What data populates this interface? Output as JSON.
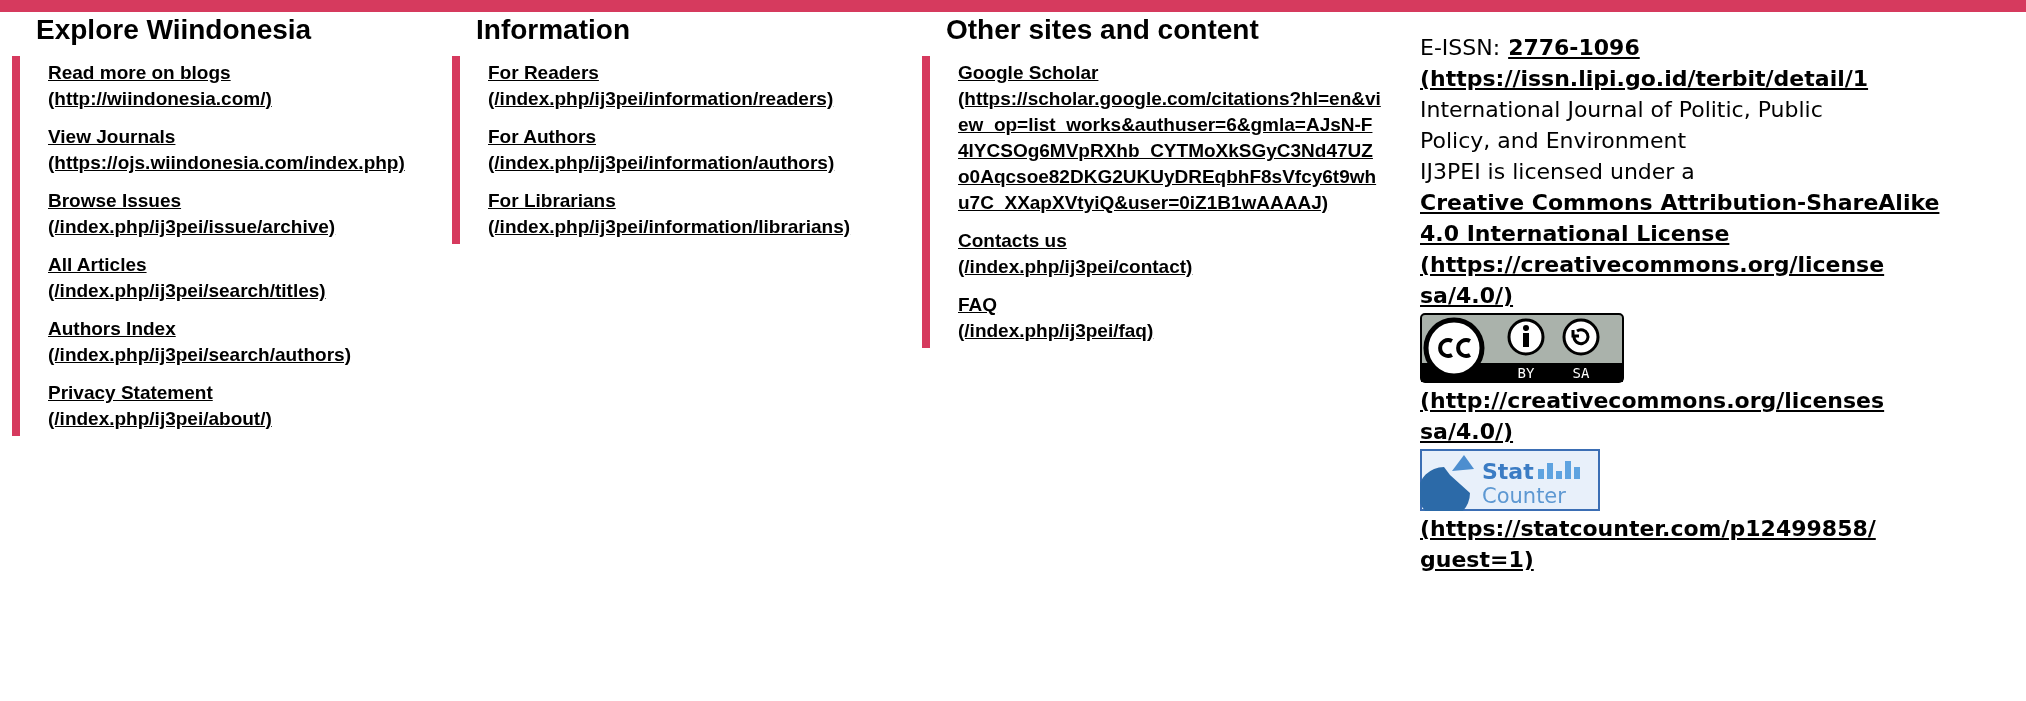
{
  "columns": [
    {
      "heading": "Explore Wiindonesia",
      "links": [
        {
          "label": "Read more on blogs",
          "url": "(http://wiindonesia.com/)"
        },
        {
          "label": "View Journals",
          "url": "(https://ojs.wiindonesia.com/index.php)"
        },
        {
          "label": "Browse Issues",
          "url": "(/index.php/ij3pei/issue/archive)"
        },
        {
          "label": "All Articles",
          "url": "(/index.php/ij3pei/search/titles)"
        },
        {
          "label": "Authors Index",
          "url": "(/index.php/ij3pei/search/authors)"
        },
        {
          "label": "Privacy Statement",
          "url": "(/index.php/ij3pei/about/)"
        }
      ]
    },
    {
      "heading": "Information",
      "links": [
        {
          "label": "For Readers",
          "url": "(/index.php/ij3pei/information/readers)"
        },
        {
          "label": "For Authors",
          "url": "(/index.php/ij3pei/information/authors)"
        },
        {
          "label": "For Librarians",
          "url": "(/index.php/ij3pei/information/librarians)"
        }
      ]
    },
    {
      "heading": "Other sites and content",
      "links": [
        {
          "label": "Google Scholar",
          "url": "(https://scholar.google.com/citations?hl=en&view_op=list_works&authuser=6&gmla=AJsN-F4lYCSOg6MVpRXhb_CYTMoXkSGyC3Nd47UZo0Aqcsoe82DKG2UKUyDREqbhF8sVfcy6t9whu7C_XXapXVtyiQ&user=0iZ1B1wAAAAJ)"
        },
        {
          "label": "Contacts us",
          "url": "(/index.php/ij3pei/contact)"
        },
        {
          "label": "FAQ",
          "url": "(/index.php/ij3pei/faq)"
        }
      ]
    }
  ],
  "journal_info": {
    "issn_label": "E-ISSN:",
    "issn": "2776-1096",
    "issn_url": "(https://issn.lipi.go.id/terbit/detail/1",
    "title": "International Journal of Politic, Public Policy, and Environment",
    "license_prefix": "IJ3PEI is licensed under a",
    "license_name": "Creative Commons Attribution-ShareAlike 4.0 International License",
    "license_url_lines": [
      "(https://creativecommons.org/license",
      "sa/4.0/)"
    ],
    "cc_badge_labels": [
      "BY",
      "SA"
    ],
    "cc_url_lines": [
      "(http://creativecommons.org/licenses",
      "sa/4.0/)"
    ],
    "statcounter_words": [
      "Stat",
      "Counter"
    ],
    "statcounter_url_lines": [
      "(https://statcounter.com/p12499858/",
      "guest=1)"
    ]
  }
}
